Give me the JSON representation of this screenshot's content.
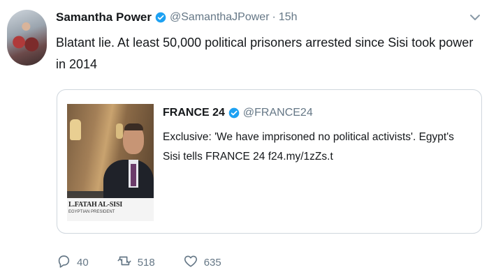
{
  "tweet": {
    "author_name": "Samantha Power",
    "author_handle": "@SamanthaJPower",
    "separator": "·",
    "time": "15h",
    "text": "Blatant lie. At least 50,000 political prisoners arrested since Sisi took power in 2014"
  },
  "quoted_tweet": {
    "author_name": "FRANCE 24",
    "author_handle": "@FRANCE24",
    "text": "Exclusive: 'We have imprisoned no political activists'. Egypt's Sisi tells FRANCE 24 f24.my/1zZs.t",
    "media_caption_name": "L.FATAH AL-SISI",
    "media_caption_role": "EGYPTIAN PRESIDENT"
  },
  "actions": {
    "replies": "40",
    "retweets": "518",
    "likes": "635"
  },
  "colors": {
    "verified": "#1da1f2",
    "muted": "#657786",
    "border": "#cfd6dd"
  },
  "icons": {
    "verified": "verified-badge-icon",
    "menu": "chevron-down-icon",
    "reply": "reply-icon",
    "retweet": "retweet-icon",
    "like": "heart-icon"
  }
}
